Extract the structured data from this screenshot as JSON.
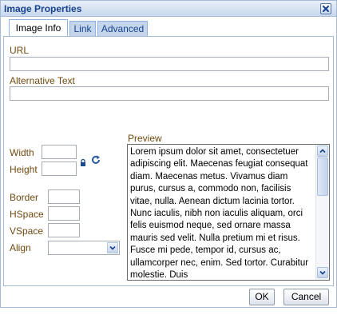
{
  "dialog": {
    "title": "Image Properties",
    "close_icon": "close-x-icon"
  },
  "tabs": [
    {
      "label": "Image Info",
      "active": true
    },
    {
      "label": "Link",
      "active": false
    },
    {
      "label": "Advanced",
      "active": false
    }
  ],
  "form": {
    "url_label": "URL",
    "url_value": "",
    "alt_label": "Alternative Text",
    "alt_value": "",
    "width_label": "Width",
    "width_value": "",
    "height_label": "Height",
    "height_value": "",
    "lock_icon": "lock-icon",
    "reset_icon": "reset-size-icon",
    "border_label": "Border",
    "border_value": "",
    "hspace_label": "HSpace",
    "hspace_value": "",
    "vspace_label": "VSpace",
    "vspace_value": "",
    "align_label": "Align",
    "align_value": ""
  },
  "preview": {
    "label": "Preview",
    "text": "Lorem ipsum dolor sit amet, consectetuer adipiscing elit. Maecenas feugiat consequat diam. Maecenas metus. Vivamus diam purus, cursus a, commodo non, facilisis vitae, nulla. Aenean dictum lacinia tortor. Nunc iaculis, nibh non iaculis aliquam, orci felis euismod neque, sed ornare massa mauris sed velit. Nulla pretium mi et risus. Fusce mi pede, tempor id, cursus ac, ullamcorper nec, enim. Sed tortor. Curabitur molestie. Duis"
  },
  "buttons": {
    "ok": "OK",
    "cancel": "Cancel"
  },
  "colors": {
    "label": "#704a10",
    "title": "#15428b",
    "border": "#a3bad9"
  }
}
